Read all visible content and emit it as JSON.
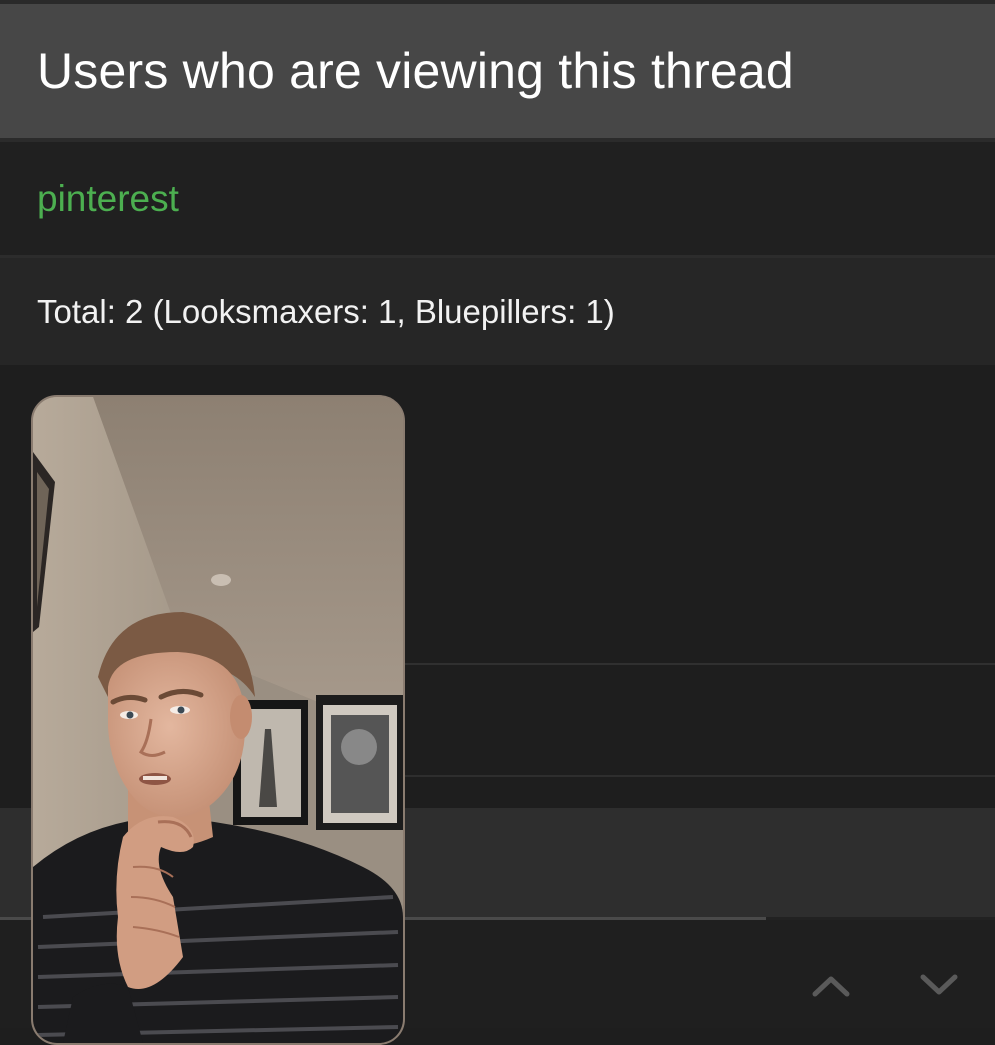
{
  "header": {
    "title": "Users who are viewing this thread"
  },
  "viewers": [
    {
      "name": "pinterest",
      "color": "#4caf50"
    }
  ],
  "summary": {
    "total_text": "Total: 2 (Looksmaxers: 1, Bluepillers: 1)"
  },
  "video_overlay": {
    "kind": "picture-in-picture camera video",
    "subject": "person-with-hand-on-chin"
  },
  "navigation": {
    "up_icon": "chevron-up-icon",
    "down_icon": "chevron-down-icon"
  },
  "scroll_progress": 0.77
}
